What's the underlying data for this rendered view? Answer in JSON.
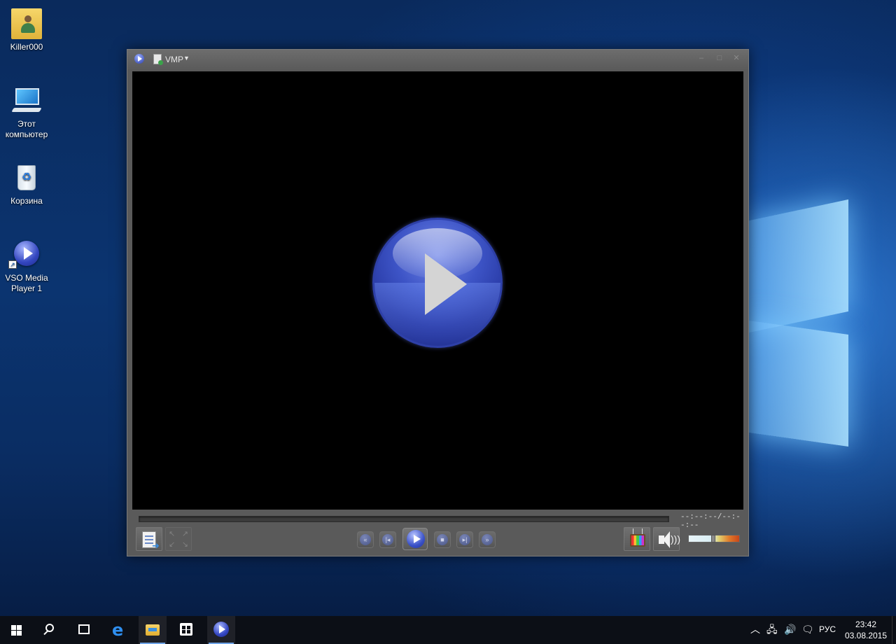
{
  "desktop": {
    "icons": [
      {
        "label": "Killer000",
        "icon": "user-folder-icon"
      },
      {
        "label": "Этот компьютер",
        "icon": "this-pc-icon"
      },
      {
        "label": "Корзина",
        "icon": "recycle-bin-icon"
      },
      {
        "label": "VSO Media Player 1",
        "icon": "vso-media-player-icon"
      }
    ]
  },
  "player": {
    "title": "VMP",
    "time_display": "--:--:--/--:--:--",
    "volume_level": 0.49,
    "accent_color": "#3d54c6"
  },
  "taskbar": {
    "language": "РУС",
    "time": "23:42",
    "date": "03.08.2015"
  }
}
